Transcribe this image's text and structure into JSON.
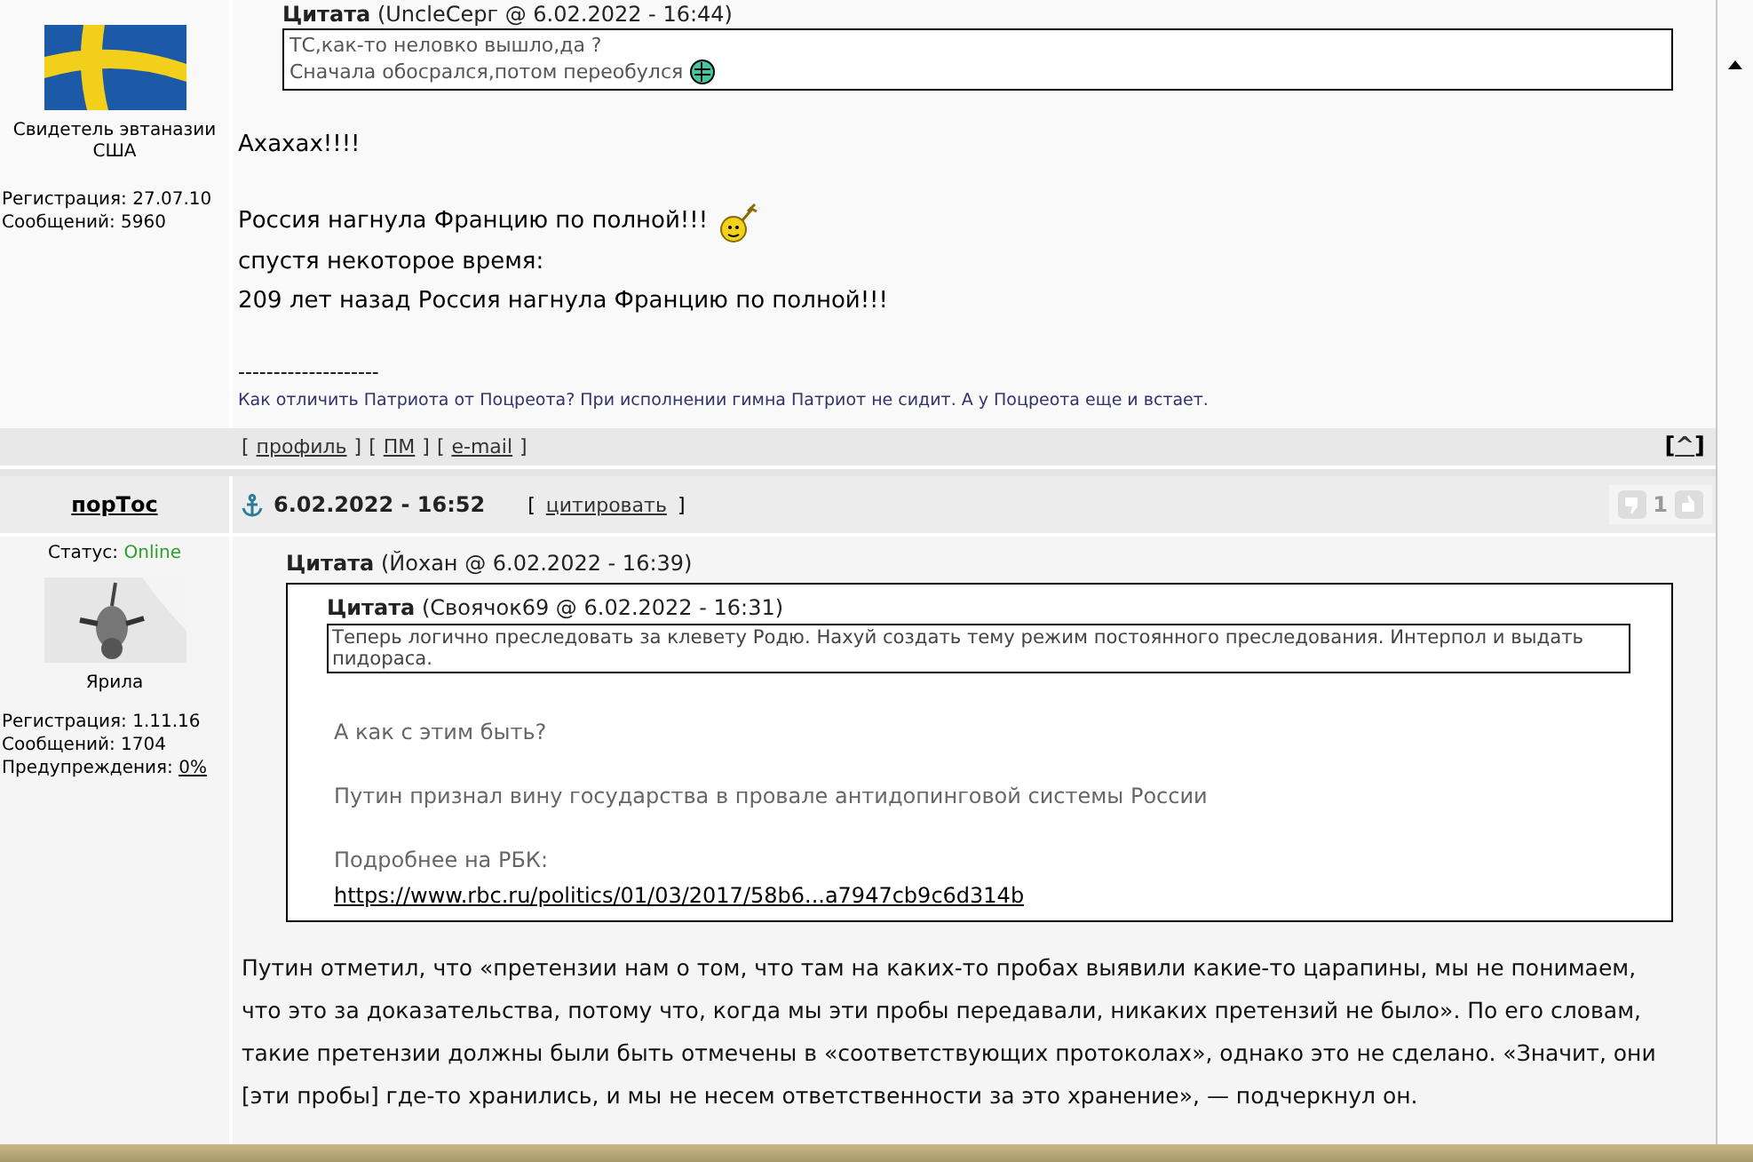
{
  "posts": [
    {
      "author": {
        "title_lines": [
          "Свидетель эвтаназии",
          "США"
        ],
        "registration": "Регистрация: 27.07.10",
        "messages": "Сообщений: 5960"
      },
      "quote": {
        "header": "**Цитата** (UncleСерг @ 6.02.2022 - 16:44)",
        "lines": [
          {
            "text": "ТС,как-то неловко вышло,да ?",
            "kind": "plain"
          },
          {
            "text": "Сначала обосрался,потом переобулся",
            "kind": "globe"
          }
        ]
      },
      "body": [
        [
          {
            "text": "Ахахах!!!!",
            "kind": "plain"
          }
        ],
        [
          {
            "text": "Россия нагнула Францию по полной!!!",
            "kind": "dancer"
          },
          {
            "text": "спустя некоторое время:",
            "kind": "plain"
          },
          {
            "text": "209 лет назад Россия нагнула Францию по полной!!!",
            "kind": "plain"
          }
        ]
      ],
      "signature": {
        "rule": "--------------------",
        "text": "Как отличить Патриота от Поцреота? При исполнении гимна Патриот не сидит. А у Поцреота еще и встает."
      },
      "footer": {
        "links": [
          {
            "open": "[",
            "label": "профиль",
            "close": "]"
          },
          {
            "open": "[",
            "label": "ПМ",
            "close": "]"
          },
          {
            "open": "[",
            "label": "e-mail",
            "close": "]"
          }
        ],
        "top_link": {
          "open": "[",
          "label": "^",
          "close": "]"
        }
      }
    },
    {
      "author": {
        "name": "порТос",
        "status_label": "Статус:",
        "status_value": "Online",
        "nickname": "Ярила",
        "registration": "Регистрация: 1.11.16",
        "messages": "Сообщений: 1704",
        "warnings_label": "Предупреждения:",
        "warnings_value": "0%"
      },
      "header": {
        "date": "6.02.2022 - 16:52",
        "quote_link": {
          "open": "[",
          "label": "цитировать",
          "close": "]"
        },
        "rating": "1"
      },
      "outer_quote": {
        "header": "**Цитата** (Йохан @ 6.02.2022 - 16:39)",
        "inner_quote": {
          "header": "**Цитата** (Своячок69 @ 6.02.2022 - 16:31)",
          "text": "Теперь логично преследовать за клевету Родю. Нахуй создать тему режим постоянного преследования. Интерпол и выдать пидораса."
        },
        "paragraphs": [
          "А как с этим быть?",
          "Путин признал вину государства в провале антидопинговой системы России",
          "Подробнее на РБК:"
        ],
        "link": "https://www.rbc.ru/politics/01/03/2017/58b6...a7947cb9c6d314b"
      },
      "body": "Путин отметил, что «претензии нам о том, что там на каких-то пробах выявили какие-то царапины, мы не понимаем, что это за доказательства, потому что, когда мы эти пробы передавали, никаких претензий не было». По его словам, такие претензии должны были быть отмечены в «соответствующих протоколах», однако это не сделано. «Значит, они [эти пробы] где-то хранились, и мы не несем ответственности за это хранение», — подчеркнул он."
    }
  ]
}
